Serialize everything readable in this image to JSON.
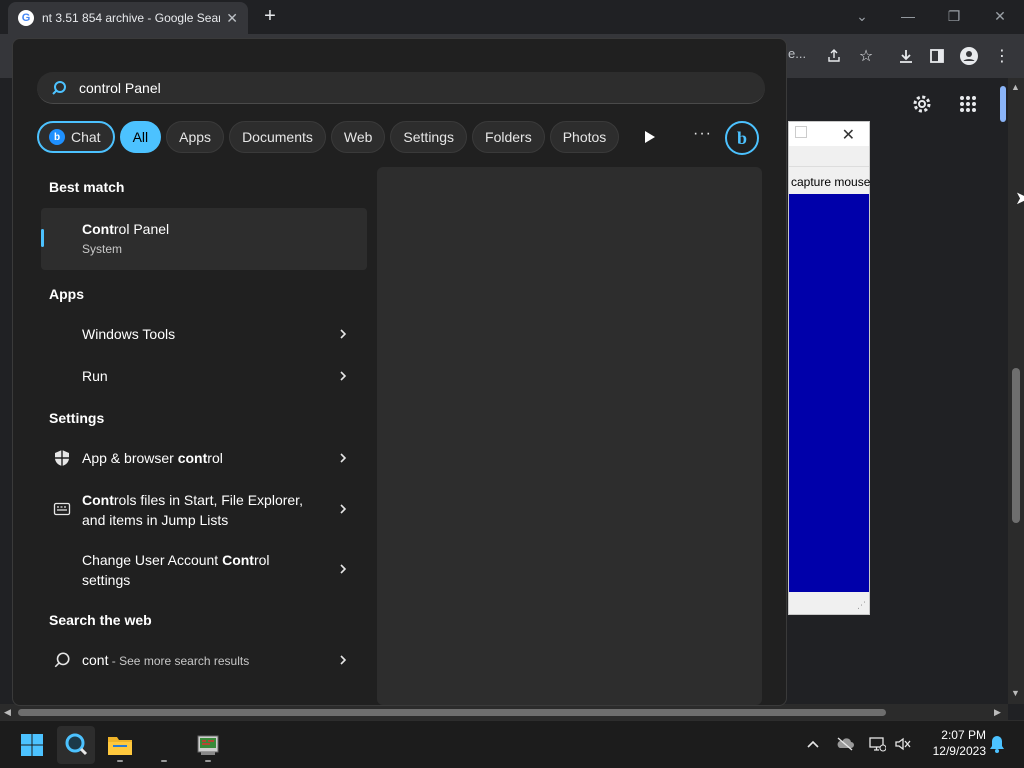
{
  "chrome": {
    "tab_title": "nt 3.51 854 archive - Google Sear",
    "tab_favicon": "G",
    "new_tab": "+",
    "omnibox_fragment": "e..."
  },
  "mini_window": {
    "label": "capture mouse"
  },
  "search": {
    "query": "control Panel",
    "chips": {
      "chat": "Chat",
      "all": "All",
      "apps": "Apps",
      "documents": "Documents",
      "web": "Web",
      "settings": "Settings",
      "folders": "Folders",
      "photos": "Photos"
    },
    "more": "···",
    "bing": "b"
  },
  "results": {
    "best_match_heading": "Best match",
    "best_match": {
      "title": "Control Panel",
      "subtitle": "System"
    },
    "apps_heading": "Apps",
    "apps": [
      {
        "label": "Windows Tools"
      },
      {
        "label": "Run"
      }
    ],
    "settings_heading": "Settings",
    "settings": [
      {
        "label_pre": "App & browser ",
        "label_bold": "cont",
        "label_post": "rol"
      },
      {
        "label_bold": "Cont",
        "label_post": "rols files in Start, File Explorer,",
        "label_line2": "and items in Jump Lists"
      },
      {
        "label_pre": "Change User Account ",
        "label_bold": "Cont",
        "label_post": "rol",
        "label_line2": "settings"
      }
    ],
    "web_heading": "Search the web",
    "web": {
      "query": "cont",
      "suffix": " - See more search results"
    }
  },
  "taskbar": {
    "time": "2:07 PM",
    "date": "12/9/2023"
  },
  "colors": {
    "accent": "#4cc2ff",
    "panel_bg": "#202020",
    "card_bg": "#2d2d2d",
    "mini_blue": "#0000aa"
  },
  "icons": [
    "search-icon",
    "play-icon",
    "more-icon",
    "bing-icon",
    "shield-icon",
    "keyboard-icon",
    "chevron-right-icon",
    "windows-start-icon",
    "folder-icon",
    "settings-gear-icon",
    "apps-grid-icon"
  ]
}
